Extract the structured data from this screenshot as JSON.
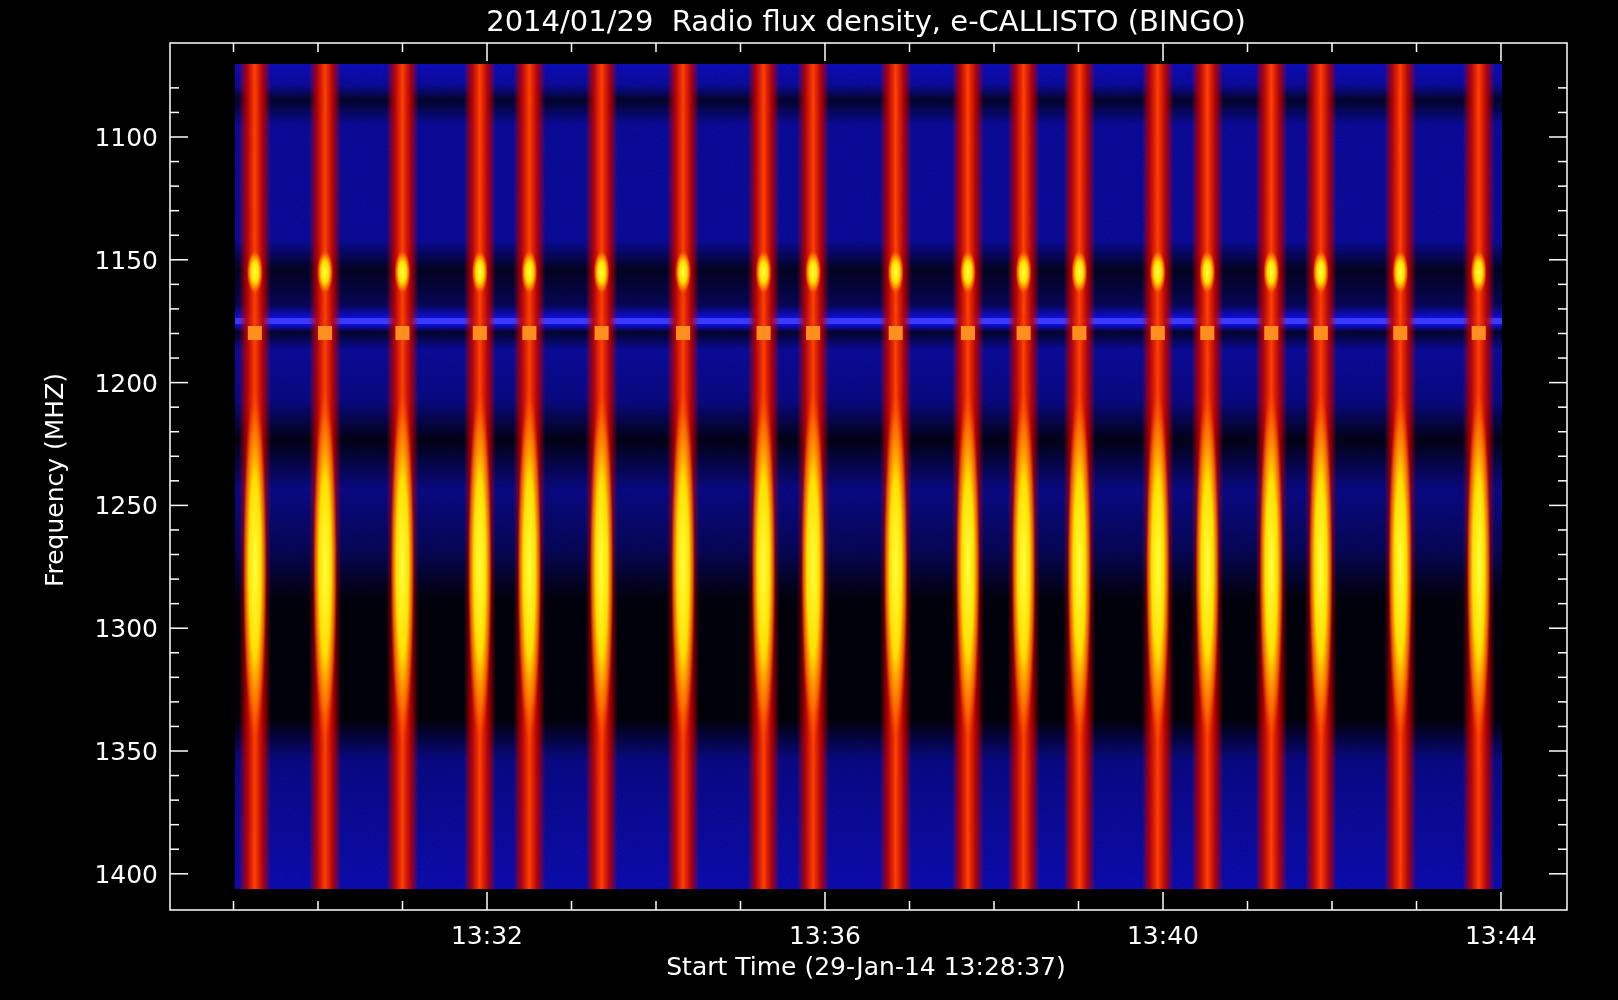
{
  "title": "2014/01/29  Radio flux density, e-CALLISTO (BINGO)",
  "ylabel": "Frequency (MHZ)",
  "xlabel": "Start Time (29-Jan-14 13:28:37)",
  "yticks": [
    "1100",
    "1150",
    "1200",
    "1250",
    "1300",
    "1350",
    "1400"
  ],
  "xticks": [
    "13:32",
    "13:36",
    "13:40",
    "13:44"
  ]
}
